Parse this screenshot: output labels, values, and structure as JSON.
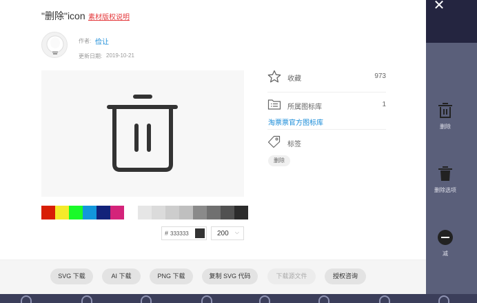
{
  "modal": {
    "title": "\"删除\"icon",
    "copyright_link": "素材版权说明",
    "author_prefix": "作者:",
    "author_name": "俭让",
    "date_prefix": "更新日期:",
    "date_value": "2019-10-21"
  },
  "palette": [
    "#d81e06",
    "#f4ea2a",
    "#1afa29",
    "#1296db",
    "#13227a",
    "#d4237a",
    "#ffffff",
    "#e6e6e6",
    "#dbdbdb",
    "#cdcdcd",
    "#bfbfbf",
    "#8a8a8a",
    "#707070",
    "#515151",
    "#2c2c2c"
  ],
  "color_input": {
    "hash": "#",
    "value": "333333",
    "chip_color": "#333333"
  },
  "size_select": {
    "value": "200"
  },
  "info": {
    "favorite_label": "收藏",
    "favorite_count": "973",
    "library_label": "所属图标库",
    "library_count": "1",
    "library_link": "淘票票官方图标库",
    "tags_label": "标签",
    "tag": "删除"
  },
  "buttons": {
    "svg": "SVG 下载",
    "ai": "AI 下载",
    "png": "PNG 下载",
    "copy_svg": "复制 SVG 代码",
    "source": "下载源文件",
    "license": "授权咨询"
  },
  "background": {
    "item1_label": "删除",
    "item2_label": "删除选项",
    "item3_label": "减"
  }
}
